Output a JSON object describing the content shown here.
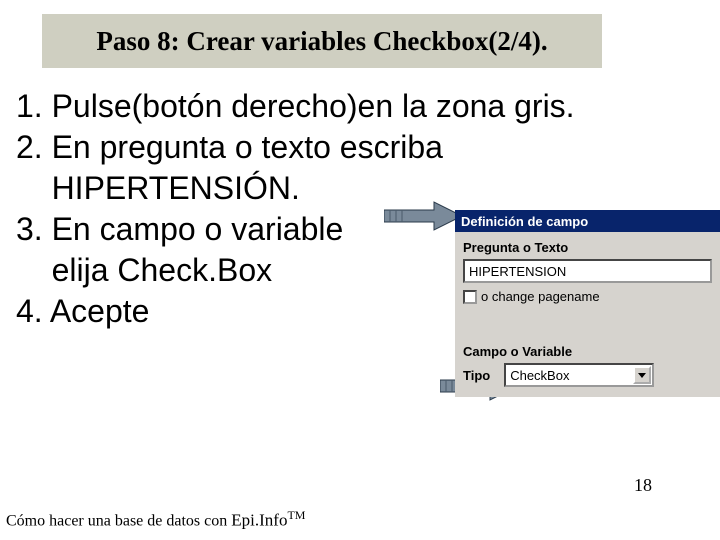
{
  "title": "Paso 8: Crear variables Checkbox(2/4).",
  "steps": {
    "l1": "1. Pulse(botón derecho)en la zona gris.",
    "l2": "2. En pregunta o texto escriba",
    "l3": "    HIPERTENSIÓN.",
    "l4": "3. En campo o variable",
    "l5": "    elija Check.Box",
    "l6": "4. Acepte"
  },
  "dialog": {
    "title": "Definición de campo",
    "question_label": "Pregunta o Texto",
    "question_value": "HIPERTENSION",
    "pagename_text": "o change pagename",
    "field_label": "Campo o Variable",
    "tipo_label": "Tipo",
    "tipo_value": "CheckBox"
  },
  "slide_number": "18",
  "footer": {
    "prefix": "Cómo hacer una base de datos con ",
    "brand": "Epi.Info",
    "tm": "TM"
  }
}
